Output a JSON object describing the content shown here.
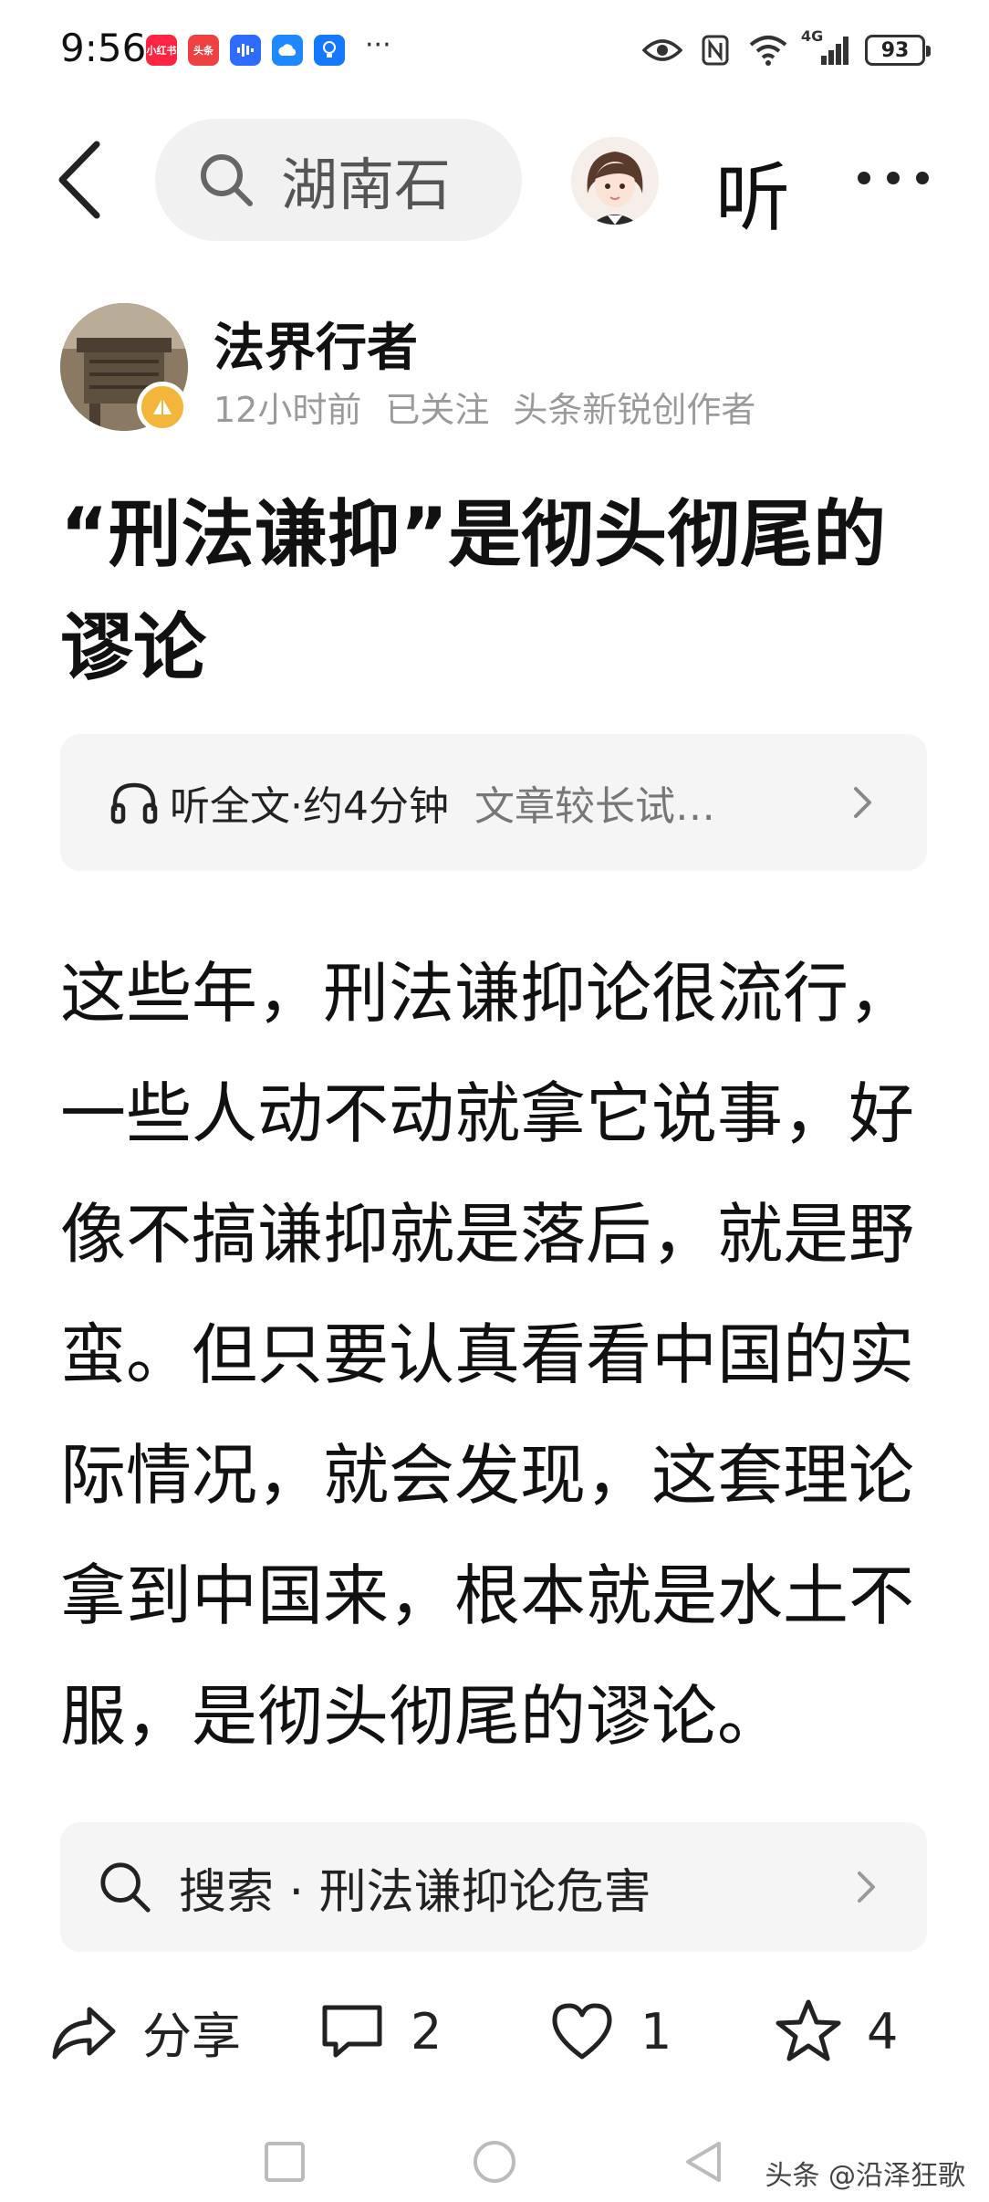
{
  "status_bar": {
    "time": "9:56",
    "app_badges": [
      {
        "label": "小红书",
        "color": "#ff2442"
      },
      {
        "label": "头条",
        "color": "#f04142"
      },
      {
        "label": "",
        "color": "#2f6bff"
      },
      {
        "label": "",
        "color": "#1e88ff"
      },
      {
        "label": "",
        "color": "#1677ff"
      }
    ],
    "more": "···",
    "network": "4G",
    "battery": "93"
  },
  "top_nav": {
    "search_query": "湖南石",
    "listen": "听"
  },
  "author": {
    "name": "法界行者",
    "time": "12小时前",
    "follow_status": "已关注",
    "tag": "头条新锐创作者"
  },
  "article": {
    "title": "“刑法谦抑”是彻头彻尾的谬论",
    "listen_card": {
      "label": "听全文·约4分钟",
      "hint": "文章较长试…"
    },
    "body": "这些年，刑法谦抑论很流行，一些人动不动就拿它说事，好像不搞谦抑就是落后，就是野蛮。但只要认真看看中国的实际情况，就会发现，这套理论拿到中国来，根本就是水土不服，是彻头彻尾的谬论。"
  },
  "search_suggestion": {
    "label": "搜索 · 刑法谦抑论危害"
  },
  "actions": {
    "share": "分享",
    "comments": "2",
    "likes": "1",
    "favorites": "4"
  },
  "watermark": "头条 @沿泽狂歌",
  "colors": {
    "accent": "#f4b63a",
    "muted_text": "#9a9a9a",
    "card_bg": "#f5f5f5"
  }
}
